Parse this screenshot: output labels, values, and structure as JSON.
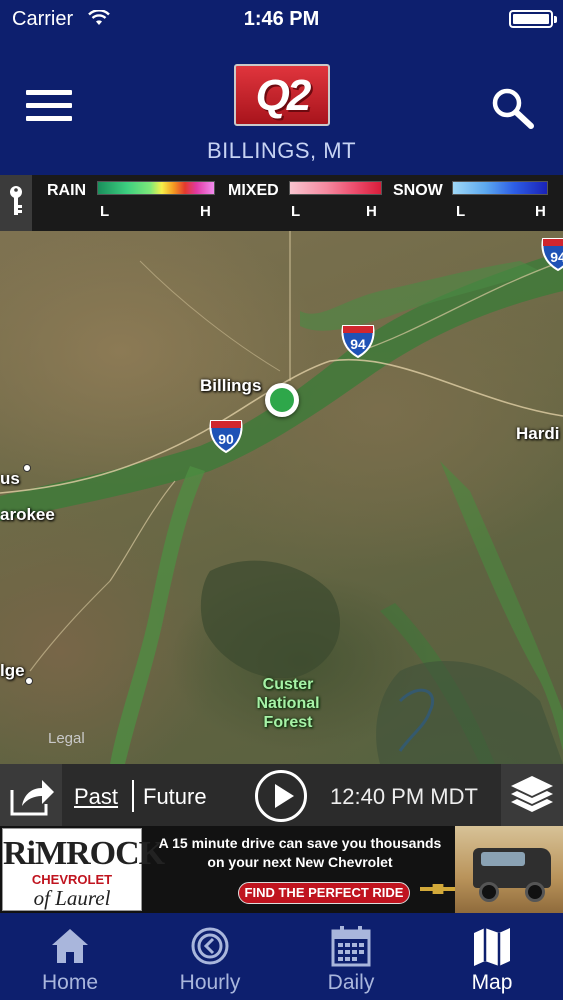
{
  "status_bar": {
    "carrier": "Carrier",
    "time": "1:46 PM"
  },
  "header": {
    "logo_text": "Q2",
    "location": "BILLINGS, MT"
  },
  "legend": {
    "rain_label": "RAIN",
    "mixed_label": "MIXED",
    "snow_label": "SNOW",
    "low": "L",
    "high": "H"
  },
  "map": {
    "labels": {
      "billings": "Billings",
      "hardin": "Hardi",
      "columbus": "us",
      "absarokee": "arokee",
      "big_timber": "lge",
      "forest_line1": "Custer",
      "forest_line2": "National",
      "forest_line3": "Forest"
    },
    "shields": {
      "i94_top": "94",
      "i94_mid": "94",
      "i90": "90"
    },
    "legal": "Legal"
  },
  "playback": {
    "past": "Past",
    "future": "Future",
    "time": "12:40 PM MDT"
  },
  "ad": {
    "brand": "RiMROCK",
    "make": "CHEVROLET",
    "town": "of Laurel",
    "headline_1": "A 15 minute drive can save you thousands",
    "headline_2": "on your next New Chevrolet",
    "cta": "FIND THE PERFECT RIDE"
  },
  "tabs": [
    {
      "label": "Home",
      "icon": "home-icon"
    },
    {
      "label": "Hourly",
      "icon": "clock-icon"
    },
    {
      "label": "Daily",
      "icon": "calendar-icon"
    },
    {
      "label": "Map",
      "icon": "map-icon",
      "active": true
    }
  ],
  "colors": {
    "header_blue": "#0d1f6e",
    "location_marker": "#2ea74a",
    "ad_red": "#c0141f"
  }
}
